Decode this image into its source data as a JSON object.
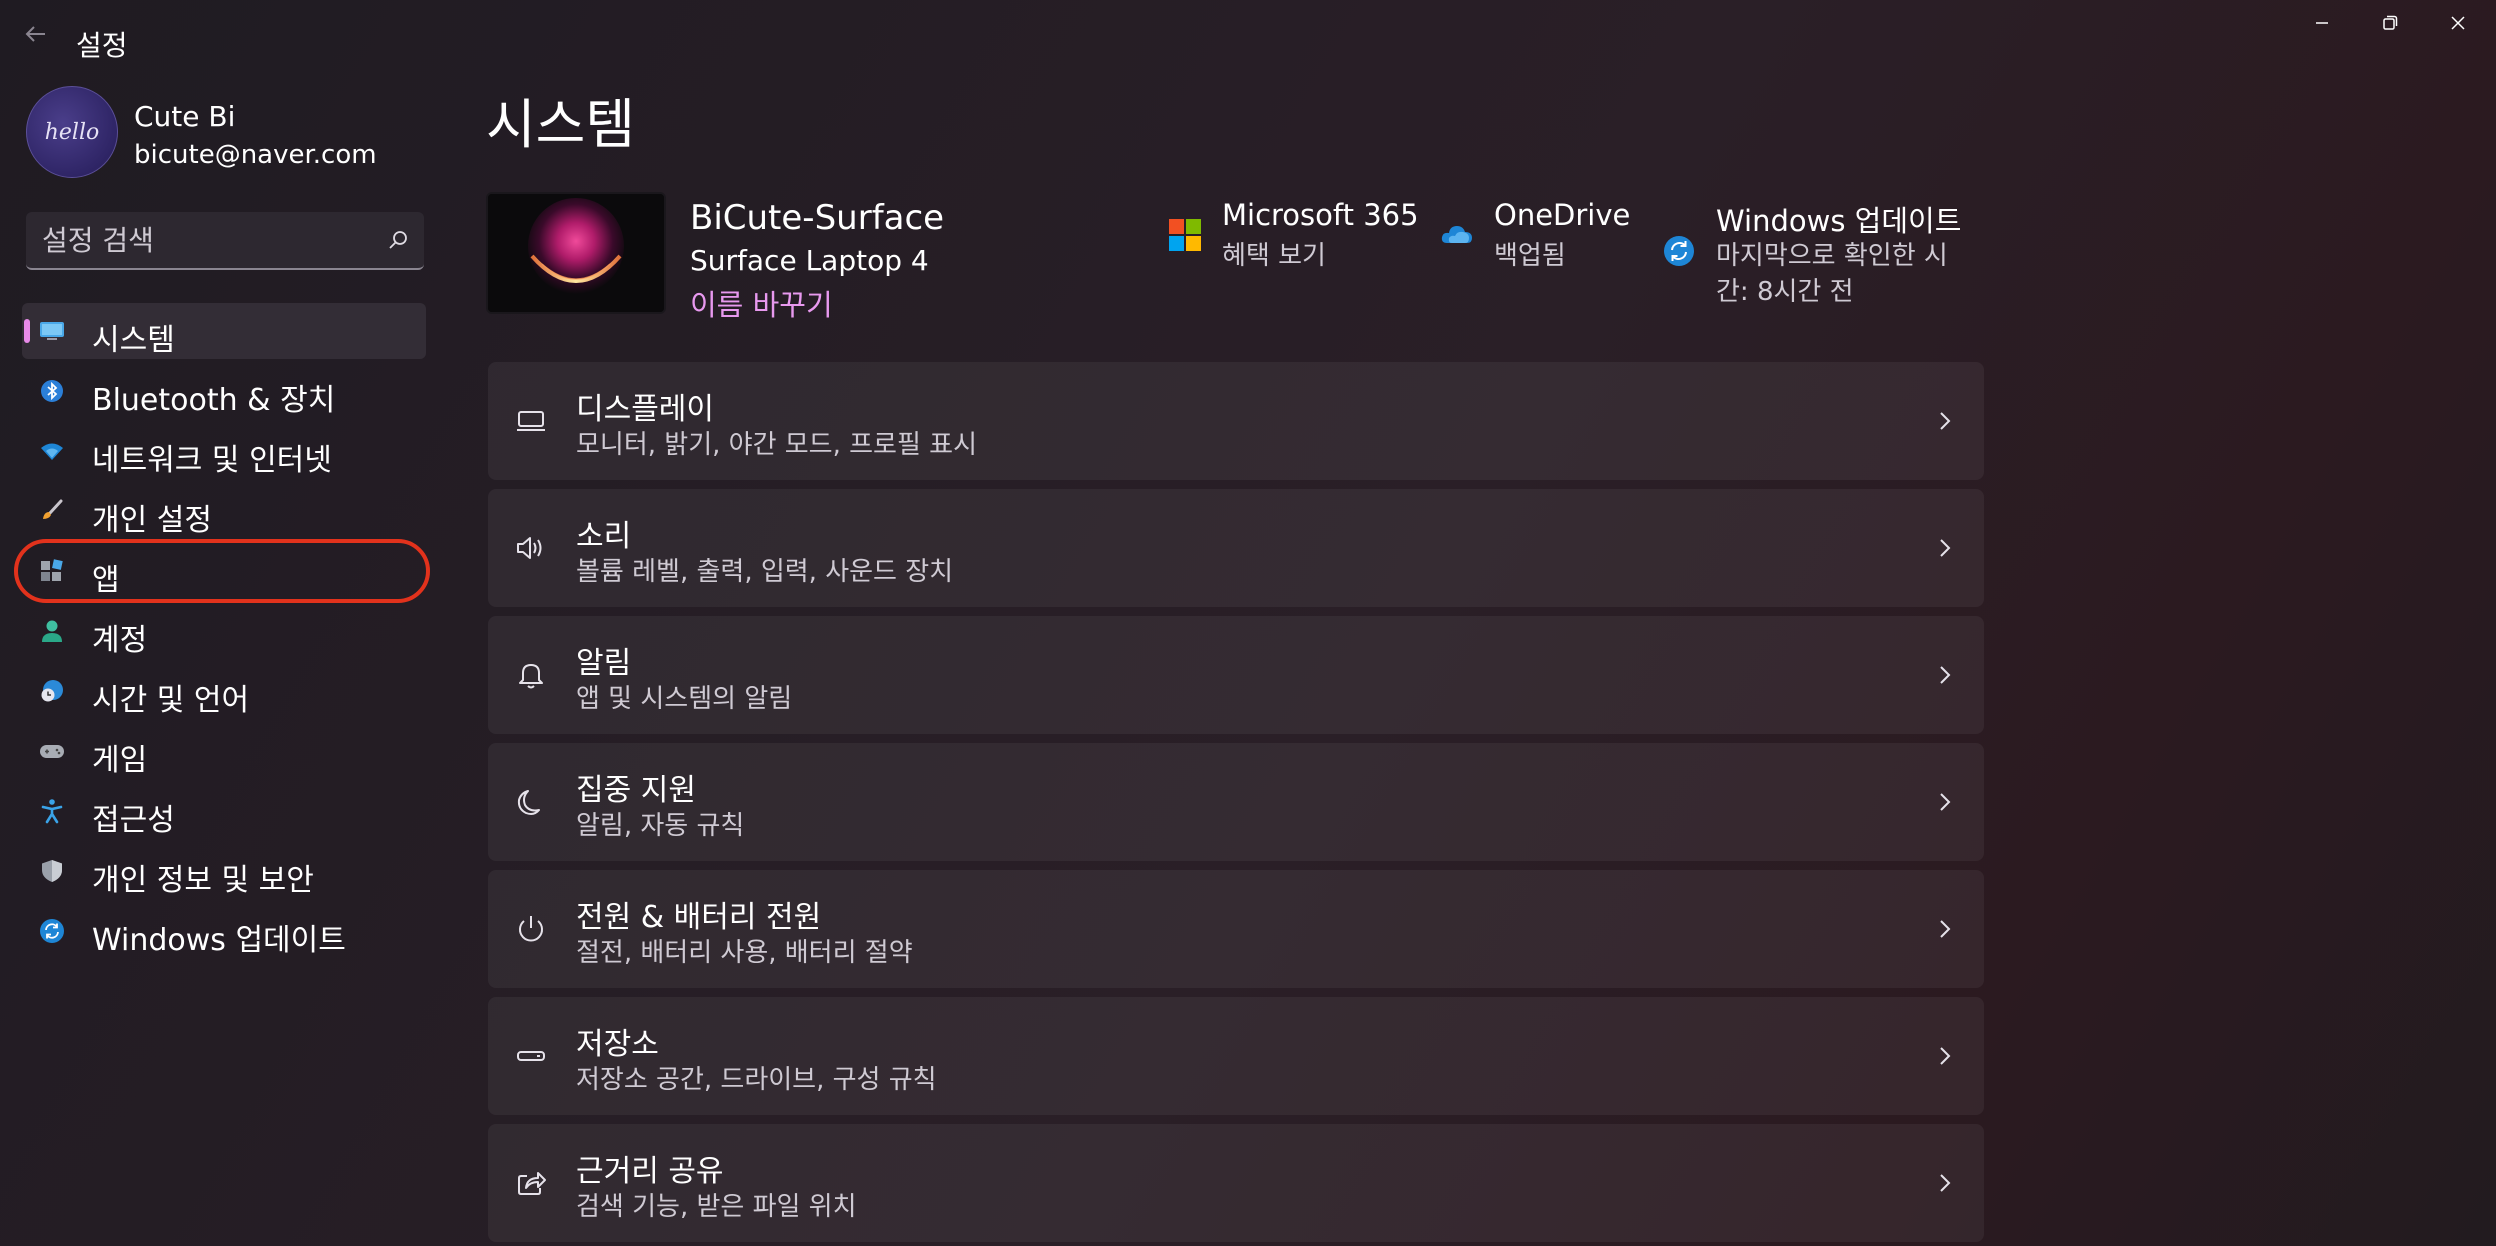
{
  "window": {
    "title": "설정",
    "back_label": "←"
  },
  "profile": {
    "avatar_text": "hello",
    "name": "Cute Bi",
    "email": "bicute@naver.com"
  },
  "search": {
    "placeholder": "설정 검색"
  },
  "sidebar": {
    "items": [
      {
        "label": "시스템",
        "icon": "monitor-icon"
      },
      {
        "label": "Bluetooth & 장치",
        "icon": "bluetooth-icon"
      },
      {
        "label": "네트워크 및 인터넷",
        "icon": "wifi-icon"
      },
      {
        "label": "개인 설정",
        "icon": "brush-icon"
      },
      {
        "label": "앱",
        "icon": "apps-icon"
      },
      {
        "label": "계정",
        "icon": "person-icon"
      },
      {
        "label": "시간 및 언어",
        "icon": "globe-clock-icon"
      },
      {
        "label": "게임",
        "icon": "gamepad-icon"
      },
      {
        "label": "접근성",
        "icon": "accessibility-icon"
      },
      {
        "label": "개인 정보 및 보안",
        "icon": "shield-icon"
      },
      {
        "label": "Windows 업데이트",
        "icon": "update-icon"
      }
    ],
    "selected_index": 0,
    "highlighted_index": 4
  },
  "main": {
    "title": "시스템",
    "device": {
      "name": "BiCute-Surface",
      "model": "Surface Laptop 4",
      "rename_label": "이름 바꾸기"
    },
    "info_cards": [
      {
        "title": "Microsoft 365",
        "subtitle": "혜택 보기",
        "icon": "microsoft-logo-icon"
      },
      {
        "title": "OneDrive",
        "subtitle": "백업됨",
        "icon": "cloud-icon"
      },
      {
        "title": "Windows 업데이트",
        "subtitle_line1": "마지막으로 확인한 시",
        "subtitle_line2": "간: 8시간 전",
        "icon": "update-icon"
      }
    ],
    "settings": [
      {
        "title": "디스플레이",
        "subtitle": "모니터, 밝기, 야간 모드, 프로필 표시",
        "icon": "display-icon"
      },
      {
        "title": "소리",
        "subtitle": "볼륨 레벨, 출력, 입력, 사운드 장치",
        "icon": "speaker-icon"
      },
      {
        "title": "알림",
        "subtitle": "앱 및 시스템의 알림",
        "icon": "bell-icon"
      },
      {
        "title": "집중 지원",
        "subtitle": "알림, 자동 규칙",
        "icon": "moon-icon"
      },
      {
        "title": "전원 & 배터리 전원",
        "subtitle": "절전, 배터리 사용, 배터리 절약",
        "icon": "power-icon"
      },
      {
        "title": "저장소",
        "subtitle": "저장소 공간, 드라이브, 구성 규칙",
        "icon": "storage-icon"
      },
      {
        "title": "근거리 공유",
        "subtitle": "검색 기능, 받은 파일 위치",
        "icon": "share-icon"
      }
    ]
  },
  "colors": {
    "accent": "#e899ef",
    "selection_indicator": "#e88ae8",
    "highlight_outline": "#e2321c",
    "background": "#221d24"
  }
}
